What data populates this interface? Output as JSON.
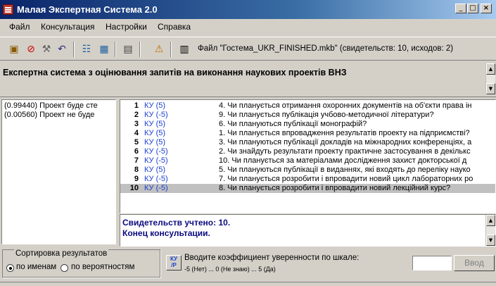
{
  "window": {
    "title": "Малая Экспертная Система 2.0"
  },
  "menu": [
    "Файл",
    "Консультация",
    "Настройки",
    "Справка"
  ],
  "toolbar": {
    "file_info": "Файл \"Гостема_UKR_FINISHED.mkb\" (свидетельств: 10, исходов: 2)"
  },
  "header": {
    "title": "Експертна система з оцінювання запитів на виконання наукових проектів ВНЗ"
  },
  "outcomes": [
    "(0.99440)  Проект буде сте",
    "(0.00560)  Проект не буде"
  ],
  "evidence": [
    {
      "num": "1",
      "ky": "КУ (5)",
      "q": "4. Чи планується отримання охоронних документів на об'єкти права ін"
    },
    {
      "num": "2",
      "ky": "КУ (-5)",
      "q": "9. Чи планується публікація учбово-методичної літератури?"
    },
    {
      "num": "3",
      "ky": "КУ (5)",
      "q": "6. Чи плануються публікації монографій?"
    },
    {
      "num": "4",
      "ky": "КУ (5)",
      "q": "1. Чи планується впровадження результатів проекту на підприємстві?"
    },
    {
      "num": "5",
      "ky": "КУ (5)",
      "q": "3. Чи плануються публікації докладів на міжнародних конференціях, а"
    },
    {
      "num": "6",
      "ky": "КУ (-5)",
      "q": "2. Чи знайдуть результати проекту практичне застосування в декількс"
    },
    {
      "num": "7",
      "ky": "КУ (-5)",
      "q": "10. Чи планується за матеріалами дослідження захист докторської д"
    },
    {
      "num": "8",
      "ky": "КУ (5)",
      "q": "5. Чи плануються публікації в виданнях, які входять до переліку науко"
    },
    {
      "num": "9",
      "ky": "КУ (-5)",
      "q": "7. Чи планується розробити і впровадити новий цикл лабораторних ро"
    },
    {
      "num": "10",
      "ky": "КУ (-5)",
      "q": "8. Чи планується розробити і впровадити новий лекційний курс?"
    }
  ],
  "messages": [
    "Свидетельств учтено: 10.",
    "Конец консультации."
  ],
  "sort": {
    "label": "Сортировка результатов",
    "by_name": "по именам",
    "by_prob": "по вероятностям"
  },
  "ky_button": {
    "top": "КУ",
    "bottom": "/Р"
  },
  "prompt": {
    "line1": "Вводите коэффициент уверенности по шкале:",
    "line2": "-5 (Нет) ... 0 (Не знаю) ... 5 (Да)"
  },
  "enter_label": "Ввод",
  "icons": [
    "open-icon",
    "stop-icon",
    "tools-icon",
    "undo-icon",
    "list-icon",
    "grid-icon",
    "settings-icon",
    "warning-icon"
  ]
}
